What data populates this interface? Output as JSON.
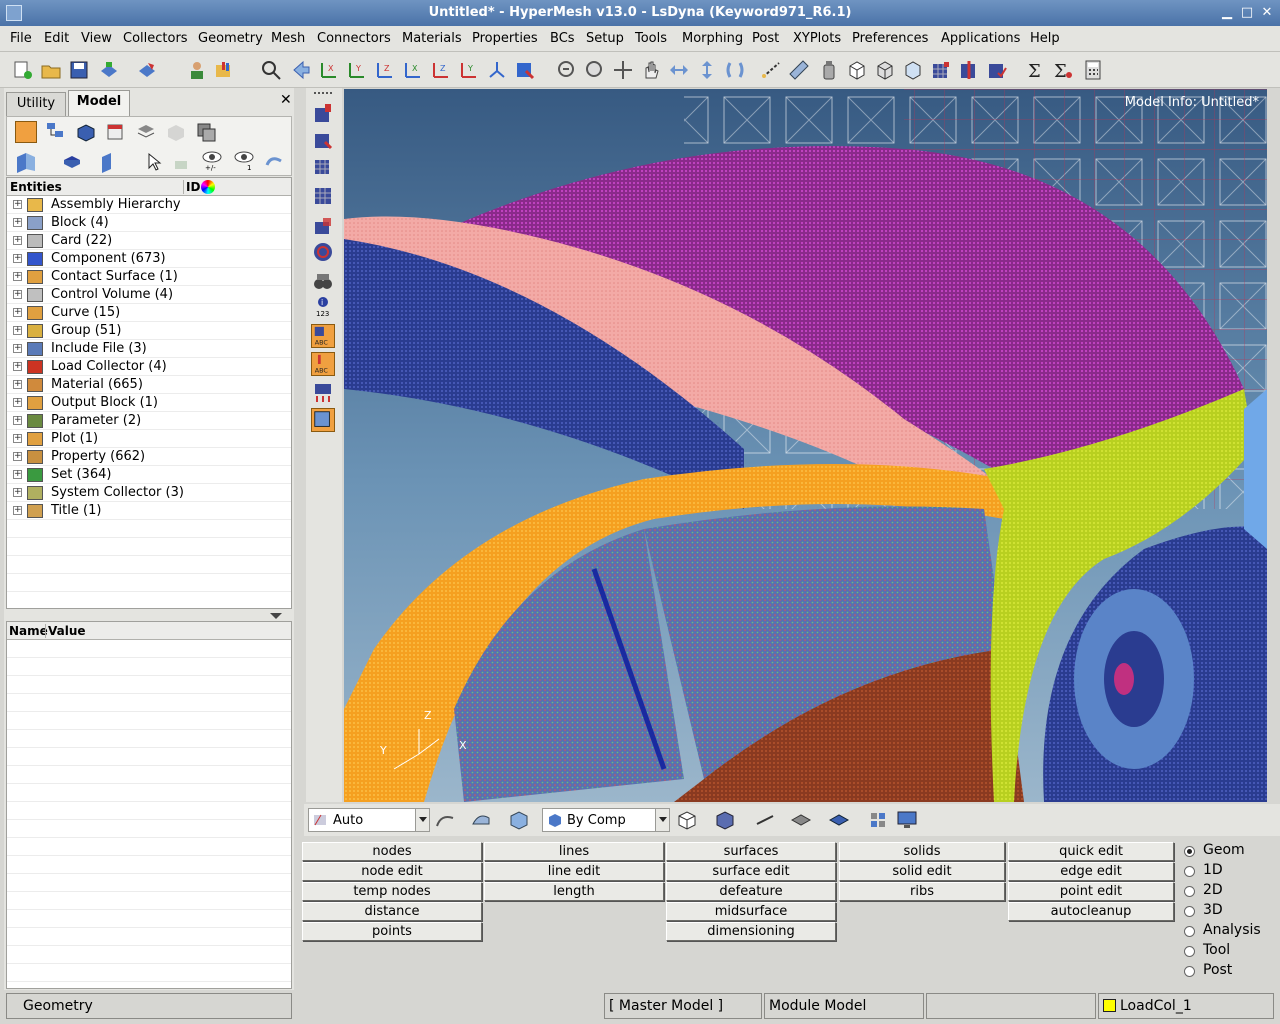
{
  "window": {
    "title": "Untitled* - HyperMesh v13.0 - LsDyna (Keyword971_R6.1)"
  },
  "menu": [
    "File",
    "Edit",
    "View",
    "Collectors",
    "Geometry",
    "Mesh",
    "Connectors",
    "Materials",
    "Properties",
    "BCs",
    "Setup",
    "Tools",
    "Morphing",
    "Post",
    "XYPlots",
    "Preferences",
    "Applications",
    "Help"
  ],
  "tabs": {
    "utility": "Utility",
    "model": "Model"
  },
  "entities": {
    "header_entities": "Entities",
    "header_id": "ID",
    "items": [
      {
        "label": "Assembly Hierarchy",
        "icon": "assembly-icon",
        "color": "#e8b84a"
      },
      {
        "label": "Block (4)",
        "icon": "block-icon",
        "color": "#8aa0c8"
      },
      {
        "label": "Card (22)",
        "icon": "card-icon",
        "color": "#bbbbbb"
      },
      {
        "label": "Component (673)",
        "icon": "component-icon",
        "color": "#3355cc"
      },
      {
        "label": "Contact Surface (1)",
        "icon": "contact-icon",
        "color": "#e0a040"
      },
      {
        "label": "Control Volume (4)",
        "icon": "control-volume-icon",
        "color": "#c0c0c0"
      },
      {
        "label": "Curve (15)",
        "icon": "curve-icon",
        "color": "#e0a040"
      },
      {
        "label": "Group (51)",
        "icon": "group-icon",
        "color": "#d9b040"
      },
      {
        "label": "Include File (3)",
        "icon": "include-icon",
        "color": "#5a7ab8"
      },
      {
        "label": "Load Collector (4)",
        "icon": "load-icon",
        "color": "#cc3322"
      },
      {
        "label": "Material (665)",
        "icon": "material-icon",
        "color": "#d08a3c"
      },
      {
        "label": "Output Block (1)",
        "icon": "output-icon",
        "color": "#e0a040"
      },
      {
        "label": "Parameter (2)",
        "icon": "parameter-icon",
        "color": "#6a8a40"
      },
      {
        "label": "Plot (1)",
        "icon": "plot-icon",
        "color": "#e0a040"
      },
      {
        "label": "Property (662)",
        "icon": "property-icon",
        "color": "#c89040"
      },
      {
        "label": "Set (364)",
        "icon": "set-icon",
        "color": "#3a9a40"
      },
      {
        "label": "System Collector (3)",
        "icon": "system-icon",
        "color": "#b0b060"
      },
      {
        "label": "Title (1)",
        "icon": "title-icon",
        "color": "#d0a050"
      }
    ]
  },
  "namevalue": {
    "name": "Name",
    "value": "Value"
  },
  "graphics": {
    "model_info": "Model Info: Untitled*"
  },
  "options": {
    "auto": "Auto",
    "by_comp": "By Comp"
  },
  "panel": {
    "col1": [
      "nodes",
      "node edit",
      "temp nodes",
      "distance",
      "points"
    ],
    "col2": [
      "lines",
      "line edit",
      "length"
    ],
    "col3": [
      "surfaces",
      "surface edit",
      "defeature",
      "midsurface",
      "dimensioning"
    ],
    "col4": [
      "solids",
      "solid edit",
      "ribs"
    ],
    "col5": [
      "quick edit",
      "edge edit",
      "point edit",
      "autocleanup"
    ],
    "modes": [
      "Geom",
      "1D",
      "2D",
      "3D",
      "Analysis",
      "Tool",
      "Post"
    ],
    "selected_mode": "Geom"
  },
  "status": {
    "left": "Geometry",
    "model": "[ Master Model ]",
    "module": "Module Model",
    "loadcol": "LoadCol_1"
  }
}
